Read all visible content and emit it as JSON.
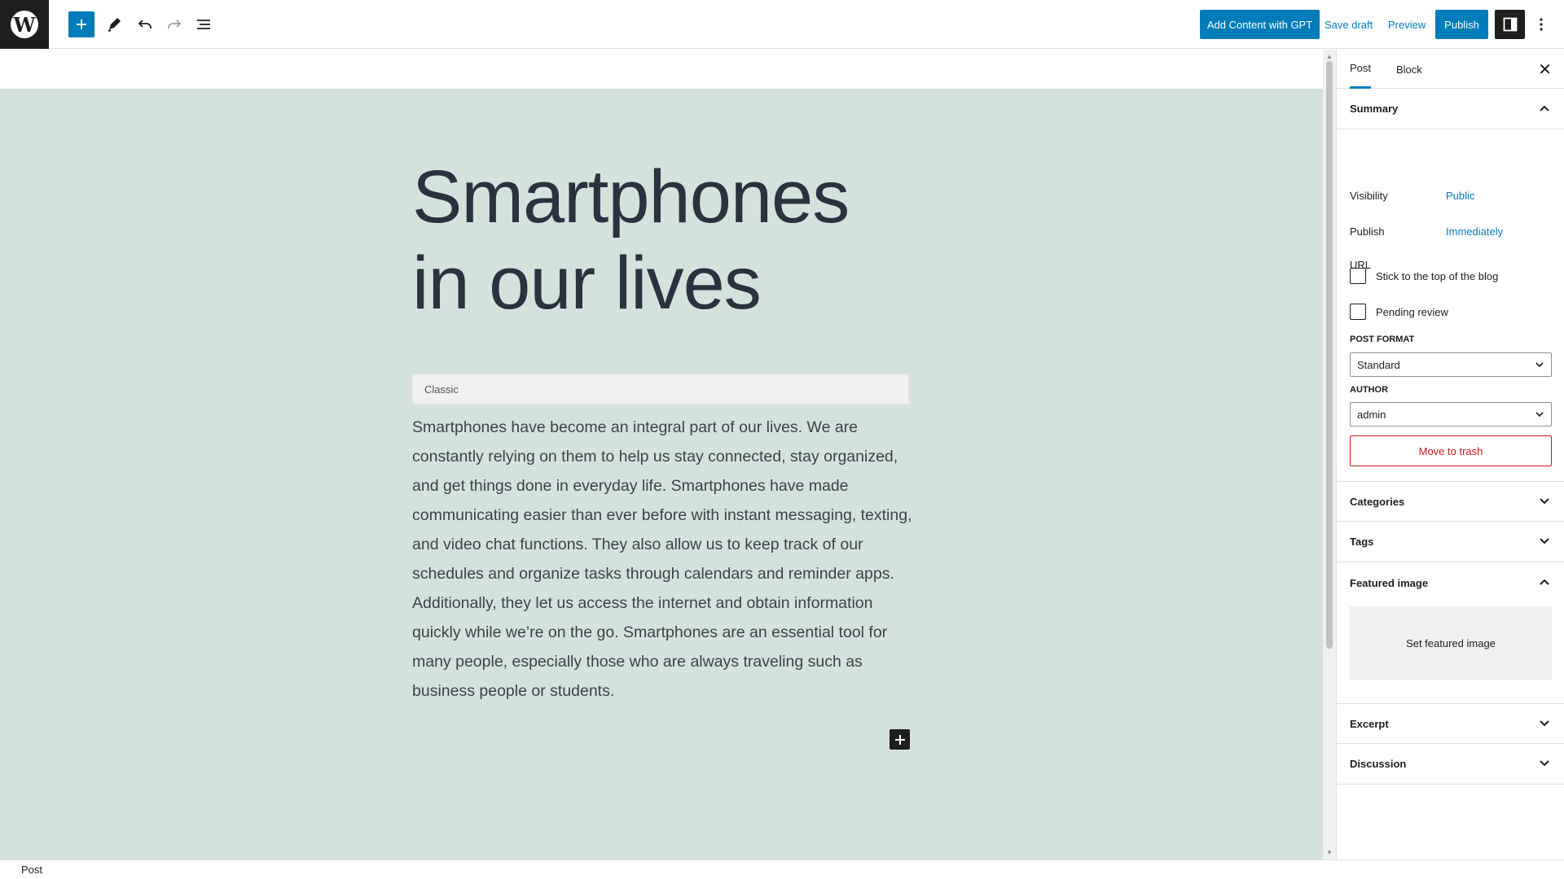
{
  "toolbar": {
    "logo_glyph": "W",
    "add_content_label": "Add Content with GPT",
    "save_draft_label": "Save draft",
    "preview_label": "Preview",
    "publish_label": "Publish",
    "accent_color": "#007cba"
  },
  "editor": {
    "title_line1": "Smartphones",
    "title_line2": "in our lives",
    "classic_label": "Classic",
    "body": "Smartphones have become an integral part of our lives. We are constantly relying on them to help us stay connected, stay organized, and get things done in everyday life. Smartphones have made communicating easier than ever before with instant messaging, texting, and video chat functions. They also allow us to keep track of our schedules and organize tasks through calendars and reminder apps. Additionally, they let us access the internet and obtain information quickly while we’re on the go. Smartphones are an essential tool for many people, especially those who are always traveling such as business people or students.",
    "background_color": "#d3e2dd"
  },
  "sidebar": {
    "tabs": [
      {
        "label": "Post"
      },
      {
        "label": "Block"
      }
    ],
    "summary": {
      "title": "Summary",
      "visibility_label": "Visibility",
      "visibility_value": "Public",
      "publish_label": "Publish",
      "publish_value": "Immediately",
      "url_label": "URL",
      "sticky_label": "Stick to the top of the blog",
      "pending_label": "Pending review",
      "post_format_label": "POST FORMAT",
      "post_format_value": "Standard",
      "author_label": "AUTHOR",
      "author_value": "admin",
      "trash_label": "Move to trash"
    },
    "panels": {
      "categories": "Categories",
      "tags": "Tags",
      "featured_image": "Featured image",
      "set_featured_image": "Set featured image",
      "excerpt": "Excerpt",
      "discussion": "Discussion"
    }
  },
  "statusbar": {
    "label": "Post"
  }
}
